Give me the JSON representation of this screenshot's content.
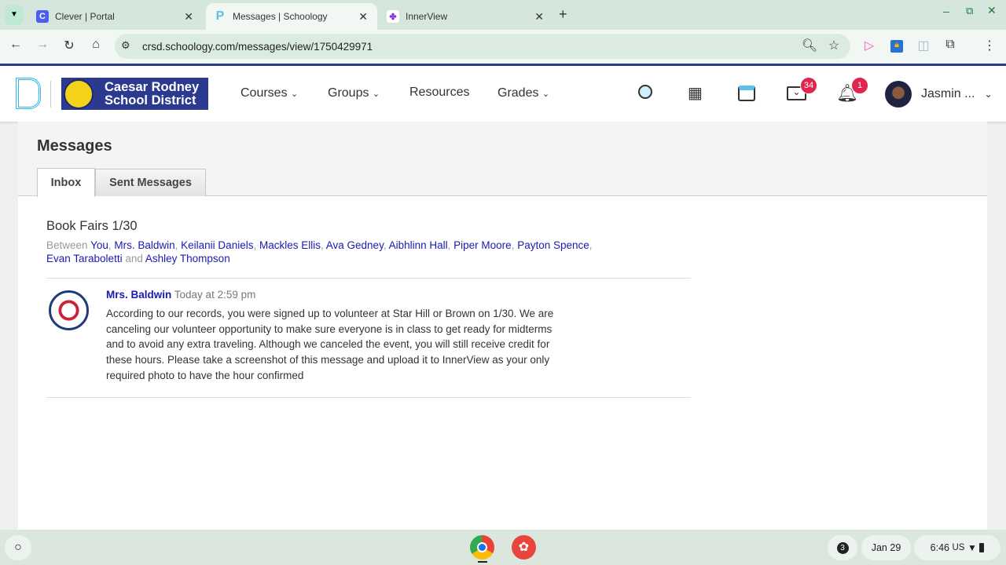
{
  "browser": {
    "tabs": [
      {
        "title": "Clever | Portal",
        "icon": "clever-icon"
      },
      {
        "title": "Messages | Schoology",
        "icon": "schoology-icon",
        "active": true
      },
      {
        "title": "InnerView",
        "icon": "innerview-icon"
      }
    ],
    "url": "crsd.schoology.com/messages/view/1750429971"
  },
  "header": {
    "district_line1": "Caesar Rodney",
    "district_line2": "School District",
    "nav": [
      "Courses",
      "Groups",
      "Resources",
      "Grades"
    ],
    "mail_count": "34",
    "notif_count": "1",
    "user": "Jasmin ..."
  },
  "page": {
    "title": "Messages",
    "tabs": [
      "Inbox",
      "Sent Messages"
    ],
    "subject": "Book Fairs 1/30",
    "between": "Between",
    "and": "and",
    "recipients": [
      "You",
      "Mrs. Baldwin",
      "Keilanii Daniels",
      "Mackles Ellis",
      "Ava Gedney",
      "Aibhlinn Hall",
      "Piper Moore",
      "Payton Spence",
      "Evan Taraboletti",
      "Ashley Thompson"
    ]
  },
  "message": {
    "author": "Mrs. Baldwin",
    "time": "Today at 2:59 pm",
    "body": "According to our records, you were signed up to volunteer at Star Hill or Brown on 1/30. We are canceling our volunteer opportunity to make sure everyone is in class to get ready for midterms and to avoid any extra traveling. Although we canceled the event, you will still receive credit for these hours. Please take a screenshot of this message and upload it to InnerView as your only required photo to have the hour confirmed"
  },
  "shelf": {
    "notifications": "3",
    "date": "Jan 29",
    "time": "6:46",
    "locale": "US"
  },
  "colors": {
    "accent": "#1a1ab0",
    "badge": "#e0254f",
    "district": "#2b3a8f"
  }
}
